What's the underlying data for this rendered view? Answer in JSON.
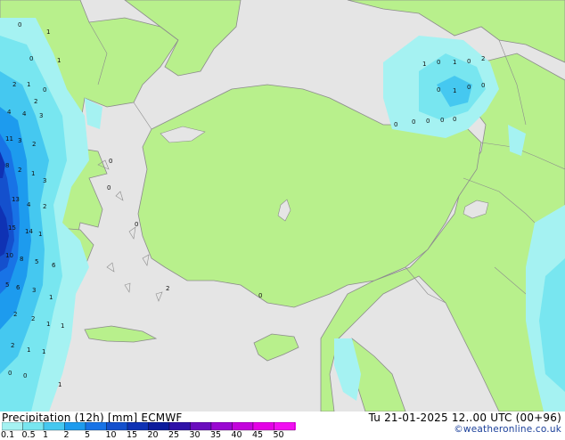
{
  "title": "Precipitation (12h) [mm] ECMWF",
  "datetime": "Tu 21-01-2025 12..00 UTC (00+96)",
  "credit": "©weatheronline.co.uk",
  "colors": {
    "sea": "#e5e5e5",
    "land": "#b8f08c",
    "border": "#8c8c8c",
    "scale": [
      "#a5f2f2",
      "#78e6f0",
      "#45c8f0",
      "#1d9bee",
      "#1873e6",
      "#1450cd",
      "#0f32b4",
      "#0c1c9c",
      "#2f12a8",
      "#6a0dbe",
      "#9a08d2",
      "#c304dc",
      "#e402e6",
      "#f20ff2"
    ]
  },
  "legend": {
    "labels": [
      "0.1",
      "0.5",
      "1",
      "2",
      "5",
      "10",
      "15",
      "20",
      "25",
      "30",
      "35",
      "40",
      "45",
      "50"
    ]
  },
  "map_values": [
    "0",
    "1",
    "0",
    "1",
    "2",
    "1",
    "0",
    "4",
    "4",
    "2",
    "3",
    "11",
    "3",
    "2",
    "8",
    "2",
    "1",
    "3",
    "13",
    "4",
    "2",
    "15",
    "14",
    "1",
    "10",
    "8",
    "5",
    "6",
    "5",
    "6",
    "3",
    "1",
    "2",
    "2",
    "1",
    "1",
    "2",
    "1",
    "1",
    "0",
    "0",
    "1",
    "0",
    "0",
    "0",
    "2",
    "0",
    "1",
    "0",
    "1",
    "0",
    "2",
    "0",
    "1",
    "0",
    "0",
    "0",
    "0",
    "0",
    "0",
    "0"
  ]
}
